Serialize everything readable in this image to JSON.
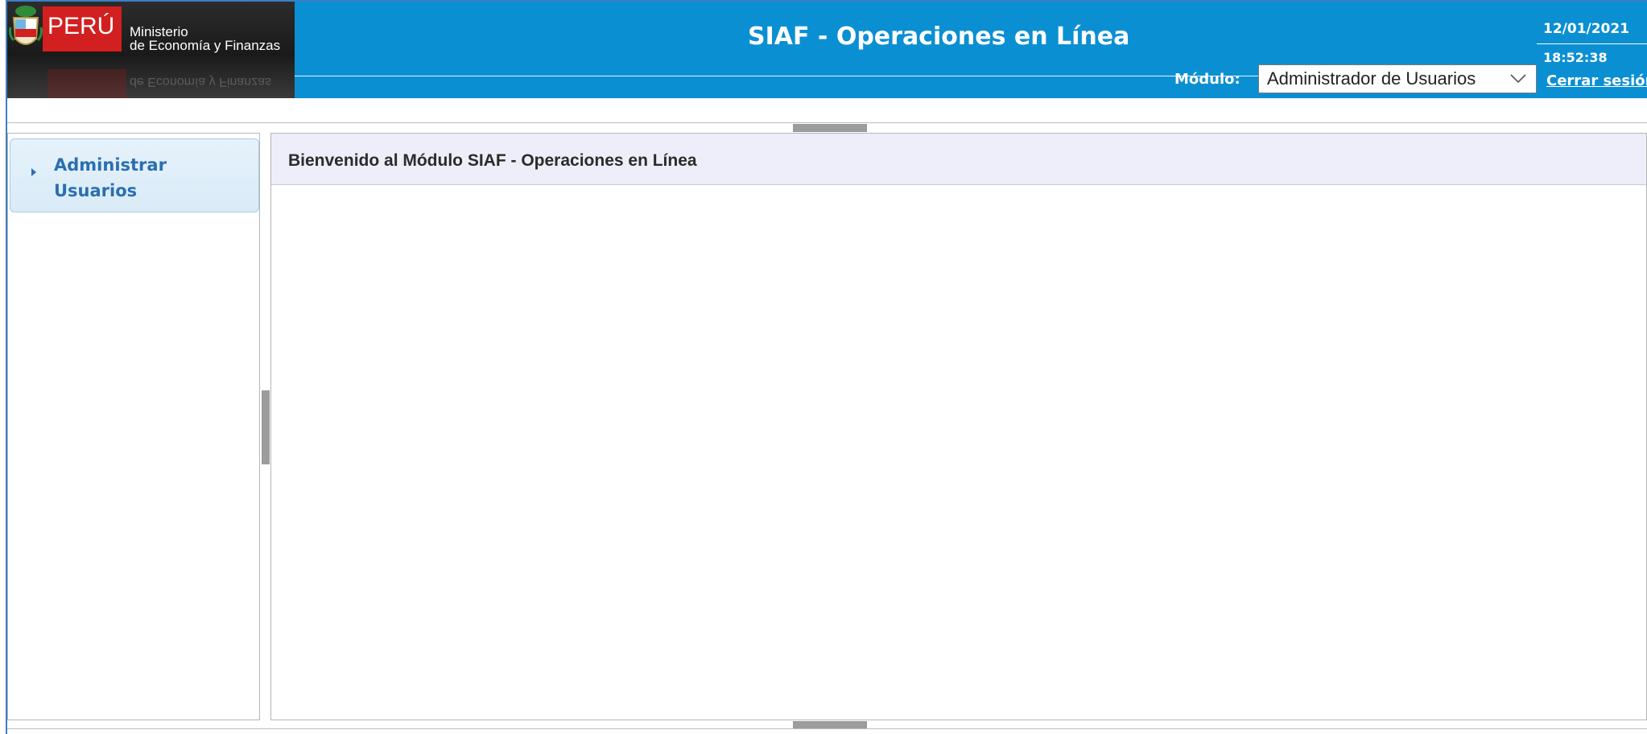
{
  "header": {
    "logo": {
      "country": "PERÚ",
      "ministry_line1": "Ministerio",
      "ministry_line2": "de Economía y Finanzas"
    },
    "app_title": "SIAF - Operaciones en Línea",
    "date": "12/01/2021",
    "time": "18:52:38",
    "modulo_label": "Módulo:",
    "modulo_value": "Administrador de Usuarios",
    "logout_label": "Cerrar sesión"
  },
  "sidebar": {
    "items": [
      {
        "label": "Administrar Usuarios",
        "icon": "triangle-right-icon"
      }
    ]
  },
  "main": {
    "header_text": "Bienvenido al Módulo SIAF - Operaciones en Línea"
  },
  "colors": {
    "header_bg": "#0b8fd3",
    "sidebar_item_text": "#2a6fb0",
    "panel_header_bg": "#eeeefa"
  }
}
